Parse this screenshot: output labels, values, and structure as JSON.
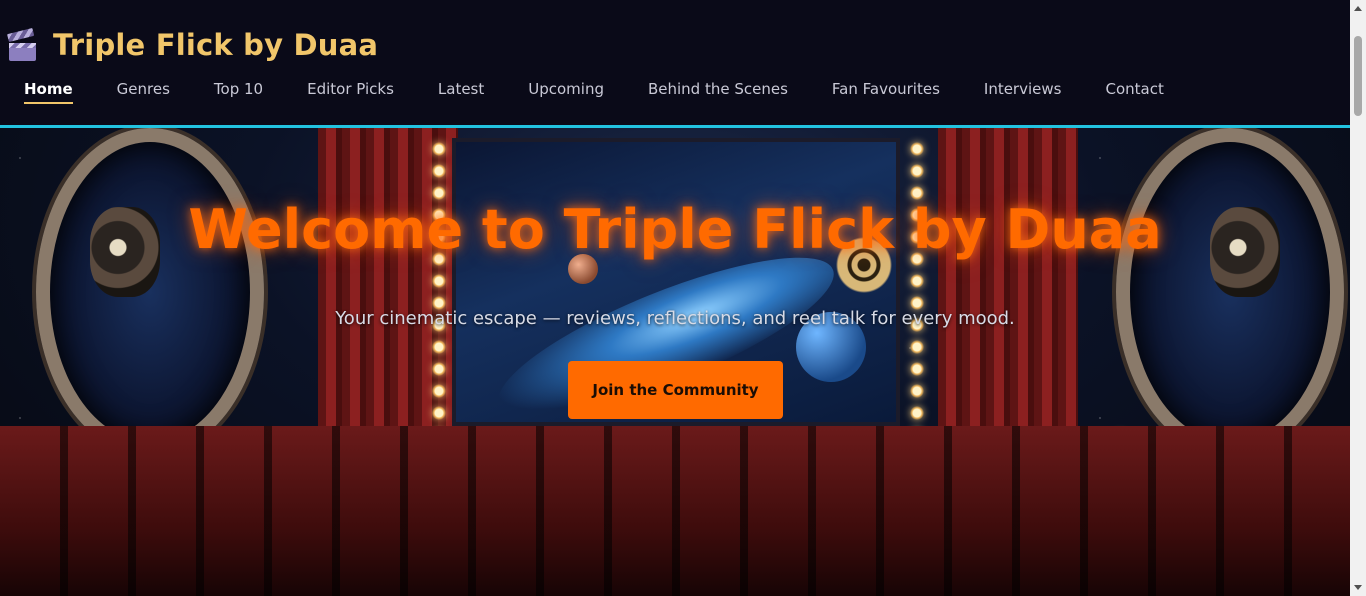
{
  "header": {
    "logo_icon": "clapperboard-icon",
    "title": "Triple Flick by Duaa"
  },
  "nav": {
    "items": [
      {
        "label": "Home",
        "active": true
      },
      {
        "label": "Genres"
      },
      {
        "label": "Top 10"
      },
      {
        "label": "Editor Picks"
      },
      {
        "label": "Latest"
      },
      {
        "label": "Upcoming"
      },
      {
        "label": "Behind the Scenes"
      },
      {
        "label": "Fan Favourites"
      },
      {
        "label": "Interviews"
      },
      {
        "label": "Contact"
      }
    ]
  },
  "hero": {
    "title": "Welcome to Triple Flick by Duaa",
    "subtitle": "Your cinematic escape — reviews, reflections, and reel talk for every mood.",
    "cta_label": "Join the Community",
    "background_image": "cinema-space-theater-illustration"
  },
  "colors": {
    "accent": "#ff6a00",
    "title_gold": "#f1c66a",
    "divider": "#22c3e0",
    "header_bg": "#0a0a18"
  }
}
